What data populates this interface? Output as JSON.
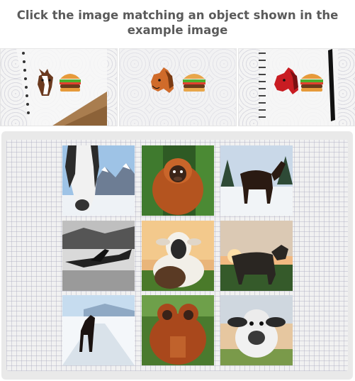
{
  "instruction": "Click the image matching an object shown in the example image",
  "examples": [
    {
      "icons": [
        "horse-icon",
        "burger-icon"
      ],
      "style": "notebook-left"
    },
    {
      "icons": [
        "horse-icon",
        "burger-icon"
      ],
      "style": "pattern"
    },
    {
      "icons": [
        "horse-icon",
        "burger-icon"
      ],
      "style": "notebook-spiral"
    }
  ],
  "grid": [
    {
      "subject": "horse",
      "scene": "mountains"
    },
    {
      "subject": "orangutan",
      "scene": "forest"
    },
    {
      "subject": "horse",
      "scene": "snow"
    },
    {
      "subject": "airplane",
      "scene": "black-and-white"
    },
    {
      "subject": "sheep",
      "scene": "field"
    },
    {
      "subject": "cow",
      "scene": "sunset"
    },
    {
      "subject": "horse",
      "scene": "snow-path"
    },
    {
      "subject": "orangutan",
      "scene": "forest"
    },
    {
      "subject": "cow",
      "scene": "sunset"
    }
  ],
  "colors": {
    "title": "#5b5b5b",
    "panel": "#e9e9e9",
    "horse_red": "#c91c22",
    "burger_bun": "#e69a3a"
  }
}
